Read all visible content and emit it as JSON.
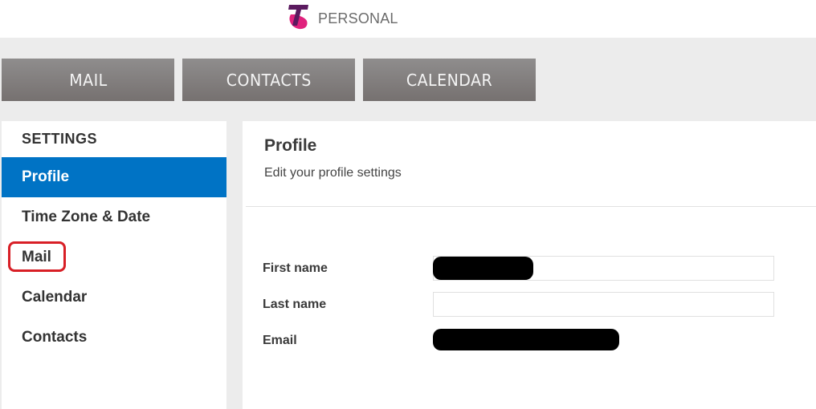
{
  "header": {
    "logo_icon": "telstra-t-logo-icon",
    "brand_text": "PERSONAL",
    "brand_color": "#e0227d",
    "brand_color_dark": "#5b1a5f"
  },
  "nav": {
    "tabs": [
      {
        "label": "MAIL"
      },
      {
        "label": "CONTACTS"
      },
      {
        "label": "CALENDAR"
      }
    ]
  },
  "sidebar": {
    "heading": "SETTINGS",
    "active_color": "#0073c5",
    "items": [
      {
        "label": "Profile",
        "active": true
      },
      {
        "label": "Time Zone & Date",
        "active": false
      },
      {
        "label": "Mail",
        "active": false,
        "highlighted": true
      },
      {
        "label": "Calendar",
        "active": false
      },
      {
        "label": "Contacts",
        "active": false
      }
    ],
    "highlight_color": "#d81f26"
  },
  "main": {
    "title": "Profile",
    "subtitle": "Edit your profile settings",
    "fields": [
      {
        "label": "First name",
        "value": "[redacted]",
        "type": "input"
      },
      {
        "label": "Last name",
        "value": "",
        "type": "input"
      },
      {
        "label": "Email",
        "value": "[redacted]",
        "type": "text"
      }
    ]
  }
}
